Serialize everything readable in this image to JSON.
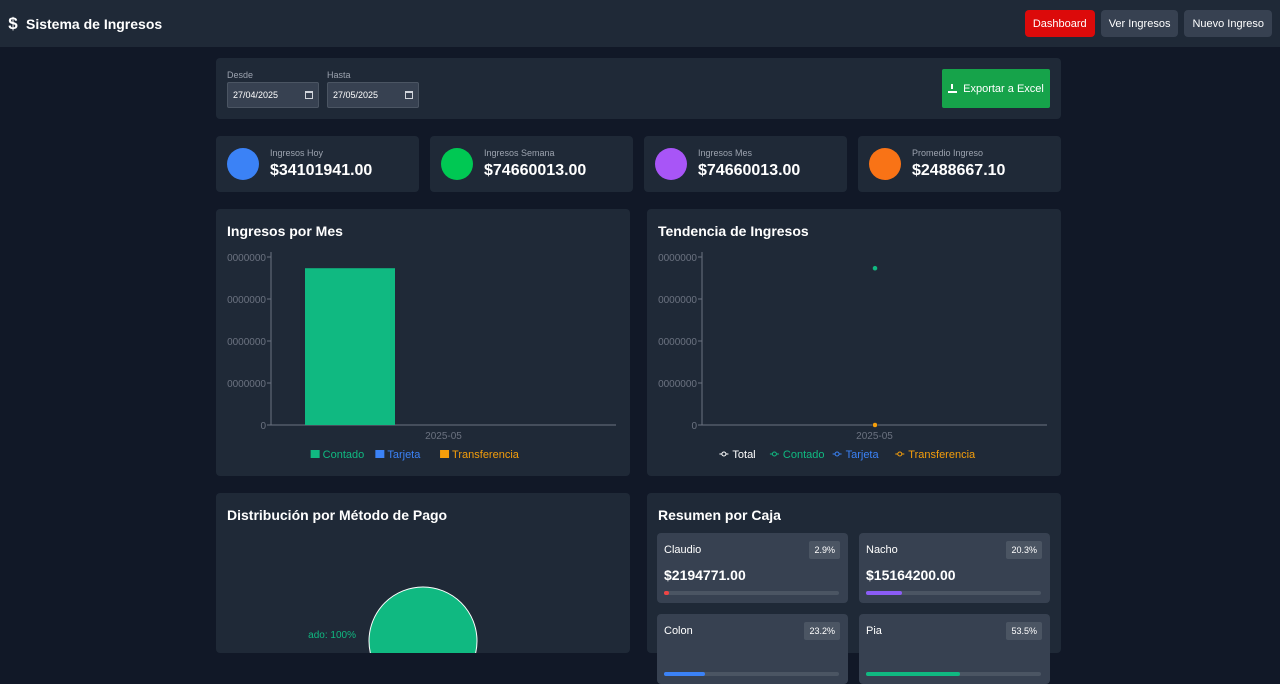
{
  "app": {
    "title": "Sistema de Ingresos",
    "icon": "dollar-icon"
  },
  "nav": [
    {
      "label": "Dashboard",
      "active": true
    },
    {
      "label": "Ver Ingresos",
      "active": false
    },
    {
      "label": "Nuevo Ingreso",
      "active": false
    }
  ],
  "filters": {
    "desde_label": "Desde",
    "desde_value": "27/04/2025",
    "hasta_label": "Hasta",
    "hasta_value": "27/05/2025",
    "export_label": "Exportar a Excel"
  },
  "stats": [
    {
      "label": "Ingresos Hoy",
      "value": "$34101941.00",
      "color": "#3b82f6"
    },
    {
      "label": "Ingresos Semana",
      "value": "$74660013.00",
      "color": "#00c853"
    },
    {
      "label": "Ingresos Mes",
      "value": "$74660013.00",
      "color": "#a855f7"
    },
    {
      "label": "Promedio Ingreso",
      "value": "$2488667.10",
      "color": "#f97316"
    }
  ],
  "bar_title": "Ingresos por Mes",
  "line_title": "Tendencia de Ingresos",
  "pie_title": "Distribución por Método de Pago",
  "caja_title": "Resumen por Caja",
  "chart_data": [
    {
      "type": "bar",
      "categories": [
        "2025-05"
      ],
      "series": [
        {
          "name": "Contado",
          "values": [
            74660013
          ],
          "color": "#10b981"
        },
        {
          "name": "Tarjeta",
          "values": [
            0
          ],
          "color": "#3b82f6"
        },
        {
          "name": "Transferencia",
          "values": [
            0
          ],
          "color": "#f59e0b"
        }
      ],
      "y_ticks": [
        "0000000",
        "0000000",
        "0000000",
        "0000000",
        "0"
      ],
      "ylim": [
        0,
        80000000
      ]
    },
    {
      "type": "line",
      "categories": [
        "2025-05"
      ],
      "series": [
        {
          "name": "Total",
          "values": [
            74660013
          ],
          "color": "#ffffff"
        },
        {
          "name": "Contado",
          "values": [
            74660013
          ],
          "color": "#10b981"
        },
        {
          "name": "Tarjeta",
          "values": [
            0
          ],
          "color": "#3b82f6"
        },
        {
          "name": "Transferencia",
          "values": [
            0
          ],
          "color": "#f59e0b"
        }
      ],
      "y_ticks": [
        "0000000",
        "0000000",
        "0000000",
        "0000000",
        "0"
      ],
      "ylim": [
        0,
        80000000
      ]
    },
    {
      "type": "pie",
      "slices": [
        {
          "label": "Contado",
          "value": 100,
          "text": "ado: 100%",
          "color": "#10b981"
        }
      ]
    }
  ],
  "cajas": [
    {
      "name": "Claudio",
      "pct": "2.9%",
      "amount": "$2194771.00",
      "fill": 0.029,
      "color": "#ef4444"
    },
    {
      "name": "Nacho",
      "pct": "20.3%",
      "amount": "$15164200.00",
      "fill": 0.203,
      "color": "#8b5cf6"
    },
    {
      "name": "Colon",
      "pct": "23.2%",
      "amount": "",
      "fill": 0.232,
      "color": "#3b82f6"
    },
    {
      "name": "Pia",
      "pct": "53.5%",
      "amount": "",
      "fill": 0.535,
      "color": "#10b981"
    }
  ]
}
